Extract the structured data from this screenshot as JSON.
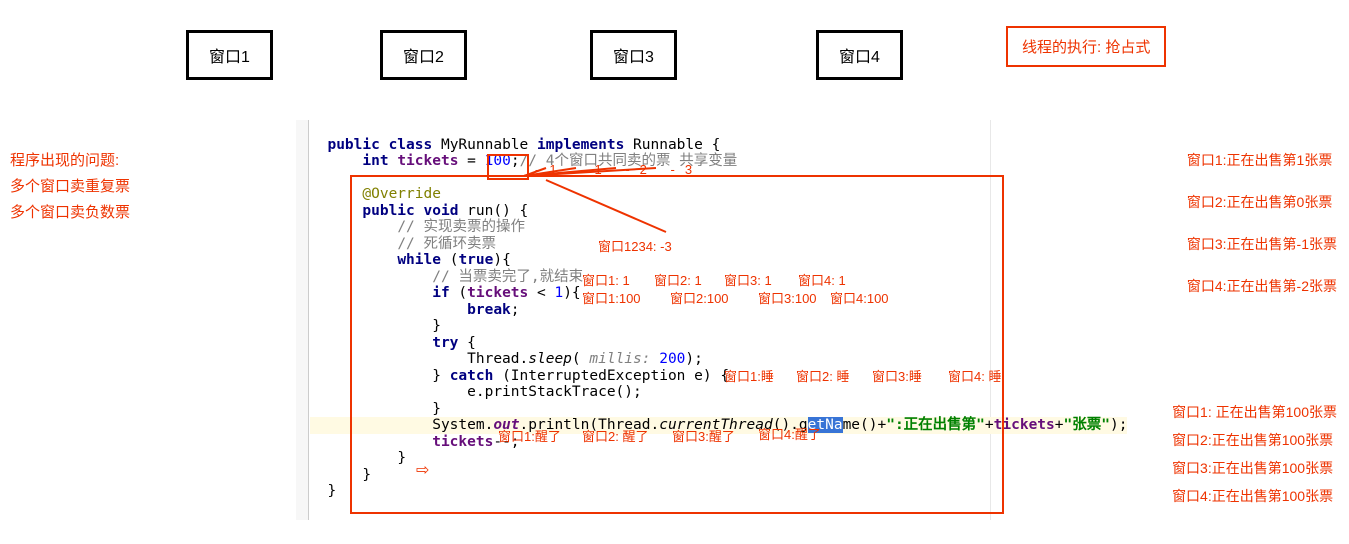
{
  "windows": [
    "窗口1",
    "窗口2",
    "窗口3",
    "窗口4"
  ],
  "thread_mode": "线程的执行: 抢占式",
  "problems": {
    "title": "程序出现的问题:",
    "line1": "多个窗口卖重复票",
    "line2": "多个窗口卖负数票"
  },
  "code": {
    "l1_kw1": "public class ",
    "l1_cls": "MyRunnable ",
    "l1_kw2": "implements ",
    "l1_if": "Runnable {",
    "l2_kw": "int ",
    "l2_fld": "tickets",
    "l2_eq": " = ",
    "l2_val": "100",
    "l2_sc": ";",
    "l2_cm": "// 4个窗口共同卖的票 共享变量",
    "l4_ov": "@Override",
    "l5": "public void ",
    "l5b": "run() {",
    "l6_cm": "// 实现卖票的操作",
    "l7_cm": "// 死循环卖票",
    "l8_kw": "while ",
    "l8_b": "(",
    "l8_tr": "true",
    "l8_c": "){",
    "l9_cm": "// 当票卖完了,就结束",
    "l10_kw": "if ",
    "l10_b": "(",
    "l10_f": "tickets",
    "l10_c": " < ",
    "l10_n": "1",
    "l10_e": "){",
    "l11_kw": "break",
    "l11_sc": ";",
    "l12": "}",
    "l13_kw": "try ",
    "l13_b": "{",
    "l14_a": "Thread.",
    "l14_it": "sleep",
    "l14_p": "( ",
    "l14_pn": "millis: ",
    "l14_v": "200",
    "l14_e": ");",
    "l15_b": "} ",
    "l15_kw": "catch ",
    "l15_p": "(InterruptedException e) {",
    "l16": "e.printStackTrace();",
    "l17": "}",
    "l18_a": "System.",
    "l18_o": "out",
    "l18_b": ".println(Thread.",
    "l18_ct": "currentThread",
    "l18_c": "().g",
    "l18_sel": "etNa",
    "l18_d": "me()+",
    "l18_s1": "\":正在出售第\"",
    "l18_p": "+",
    "l18_f": "tickets",
    "l18_p2": "+",
    "l18_s2": "\"张票\"",
    "l18_e": ");",
    "l19_f": "tickets",
    "l19_d": "--;",
    "l20": "}",
    "l21": "}",
    "l22": "}"
  },
  "annot": {
    "minus1_labels": "-1    -1    -2    -3",
    "w1234_n3": "窗口1234:  -3",
    "row1": {
      "a": "窗口1: 1",
      "b": "窗口2: 1",
      "c": "窗口3: 1",
      "d": "窗口4: 1"
    },
    "row2": {
      "a": "窗口1:100",
      "b": "窗口2:100",
      "c": "窗口3:100",
      "d": "窗口4:100"
    },
    "sleep": {
      "a": "窗口1:睡",
      "b": "窗口2: 睡",
      "c": "窗口3:睡",
      "d": "窗口4: 睡"
    },
    "wake": {
      "a": "窗口1:醒了",
      "b": "窗口2: 醒了",
      "c": "窗口3:醒了",
      "d": "窗口4:醒了"
    }
  },
  "right_group1": [
    "窗口1:正在出售第1张票",
    "窗口2:正在出售第0张票",
    "窗口3:正在出售第-1张票",
    "窗口4:正在出售第-2张票"
  ],
  "right_group2": [
    "窗口1: 正在出售第100张票",
    "窗口2:正在出售第100张票",
    "窗口3:正在出售第100张票",
    "窗口4:正在出售第100张票"
  ]
}
